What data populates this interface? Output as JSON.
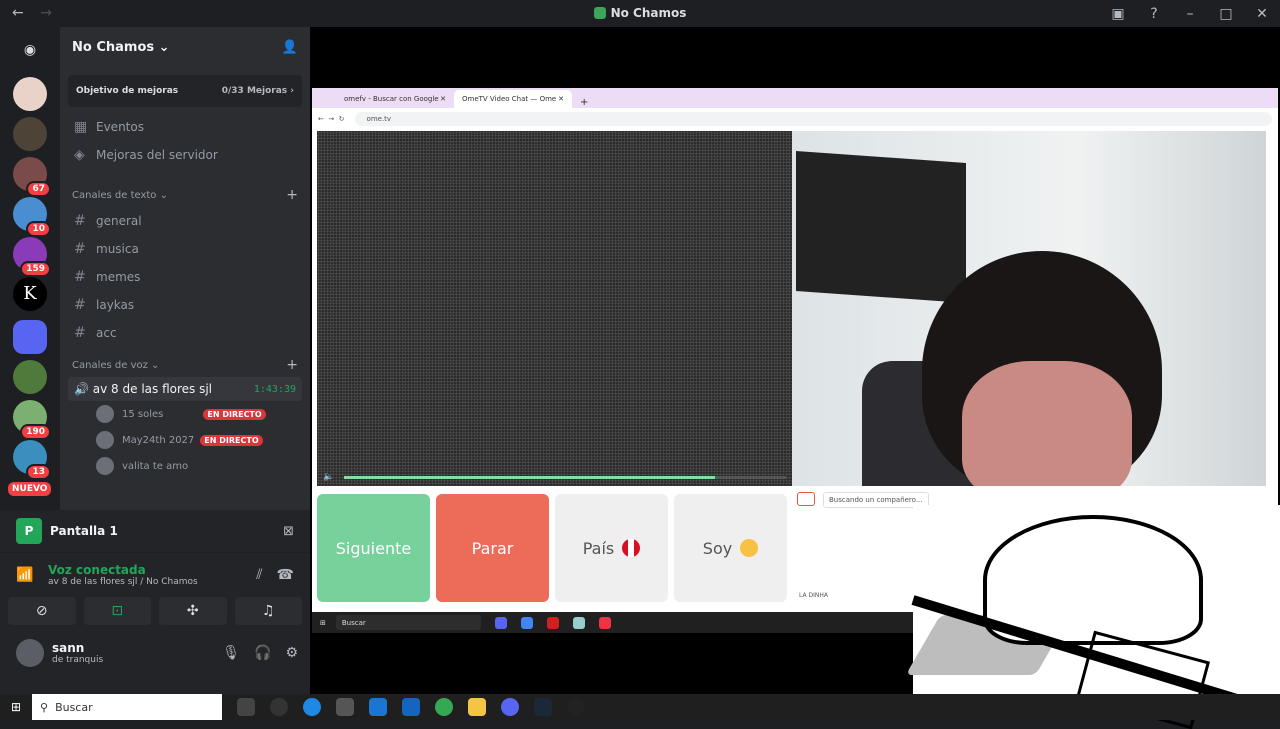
{
  "window": {
    "title": "No Chamos",
    "back": "←",
    "forward": "→"
  },
  "guilds": {
    "badges": [
      "67",
      "10",
      "159",
      "190",
      "13"
    ],
    "k_letter": "K",
    "nuevo": "NUEVO"
  },
  "server": {
    "name": "No Chamos",
    "boost_goal_label": "Objetivo de mejoras",
    "boost_goal_value": "0/33 Mejoras",
    "events": "Eventos",
    "server_boosts": "Mejoras del servidor",
    "text_category": "Canales de texto",
    "text_channels": [
      "general",
      "musica",
      "memes",
      "laykas",
      "acc"
    ],
    "voice_category": "Canales de voz",
    "voice_channel": "av 8 de las flores sjl",
    "voice_time": "1:43:39",
    "voice_users": [
      {
        "name": "15 soles",
        "live": "EN DIRECTO"
      },
      {
        "name": "May24th 2027",
        "live": "EN DIRECTO"
      },
      {
        "name": "valita te amo",
        "live": ""
      }
    ]
  },
  "panel": {
    "screen_initial": "P",
    "screen_name": "Pantalla 1",
    "voice_status": "Voz conectada",
    "voice_location": "av 8 de las flores sjl / No Chamos",
    "username": "sann",
    "user_status": "de tranquis"
  },
  "browser": {
    "tab1": "omefv - Buscar con Google",
    "tab2": "OmeTV Video Chat — Ome",
    "url": "ome.tv",
    "searching": "Buscando un compañero...",
    "footer": "LA DINHA",
    "btn_next": "Siguiente",
    "btn_stop": "Parar",
    "btn_country": "País",
    "btn_gender": "Soy",
    "inner_search": "Buscar"
  },
  "taskbar": {
    "search": "Buscar"
  },
  "colors": {
    "online_green": "#23a55a",
    "danger_red": "#f23f43",
    "next_green": "#76d19b",
    "stop_red": "#ec6b59"
  }
}
